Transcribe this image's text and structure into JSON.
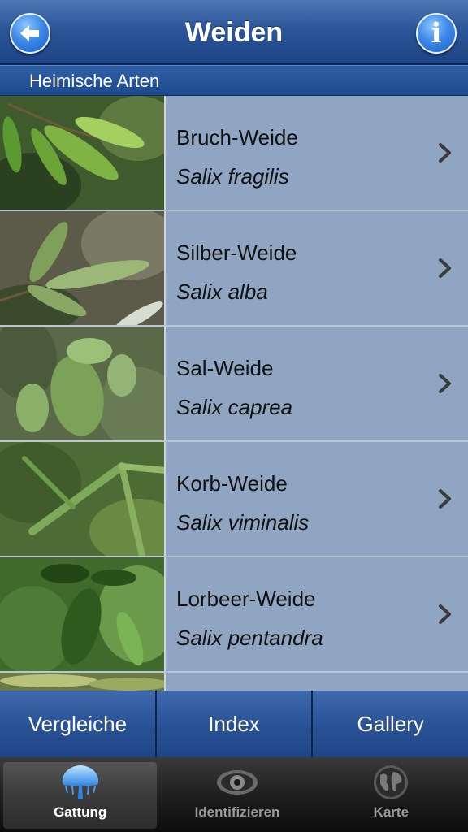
{
  "header": {
    "title": "Weiden",
    "back_icon": "back-arrow-icon",
    "info_icon": "info-icon",
    "info_glyph": "i"
  },
  "section": {
    "title": "Heimische Arten"
  },
  "species": [
    {
      "name": "Bruch-Weide",
      "latin": "Salix fragilis"
    },
    {
      "name": "Silber-Weide",
      "latin": "Salix alba"
    },
    {
      "name": "Sal-Weide",
      "latin": "Salix caprea"
    },
    {
      "name": "Korb-Weide",
      "latin": "Salix viminalis"
    },
    {
      "name": "Lorbeer-Weide",
      "latin": "Salix pentandra"
    },
    {
      "name": "",
      "latin": ""
    }
  ],
  "segments": {
    "compare": "Vergleiche",
    "index": "Index",
    "gallery": "Gallery"
  },
  "tabs": [
    {
      "label": "Gattung",
      "icon": "tree-icon",
      "active": true
    },
    {
      "label": "Identifizieren",
      "icon": "eye-icon",
      "active": false
    },
    {
      "label": "Karte",
      "icon": "globe-icon",
      "active": false
    }
  ],
  "colors": {
    "header_blue": "#2b5699",
    "list_bg": "#8fa5c2",
    "active_tab": "#3b3b3b"
  }
}
